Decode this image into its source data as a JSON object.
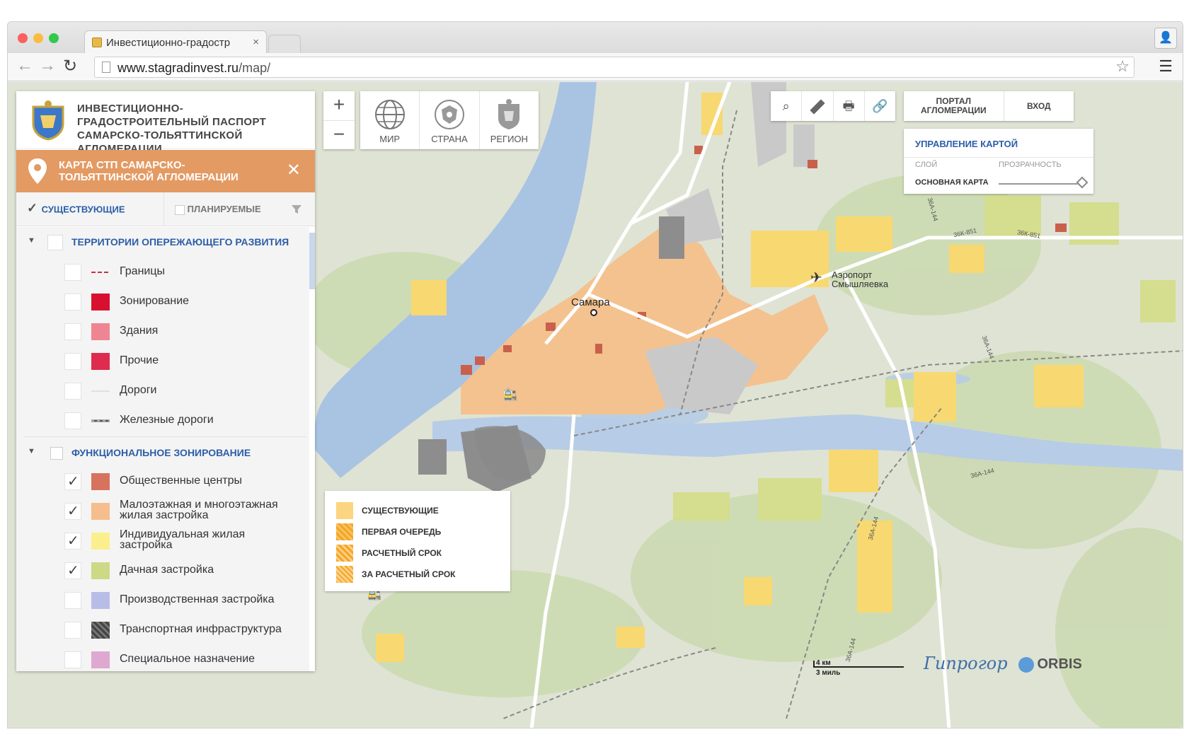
{
  "browser": {
    "tab_title": "Инвестиционно-градостр",
    "url_host": "www.stagradinvest.ru",
    "url_path": "/map/"
  },
  "header": {
    "title": "ИНВЕСТИЦИОННО-ГРАДОСТРОИТЕЛЬНЫЙ ПАСПОРТ САМАРСКО-ТОЛЬЯТТИНСКОЙ АГЛОМЕРАЦИИ"
  },
  "map_card": {
    "title": "КАРТА СТП САМАРСКО-ТОЛЬЯТТИНСКОЙ АГЛОМЕРАЦИИ"
  },
  "filters": {
    "existing": "СУЩЕСТВУЮЩИЕ",
    "planned": "ПЛАНИРУЕМЫЕ"
  },
  "groups": [
    {
      "title": "ТЕРРИТОРИИ ОПЕРЕЖАЮЩЕГО РАЗВИТИЯ",
      "items": [
        {
          "label": "Границы",
          "checked": false,
          "color": "#c8313e"
        },
        {
          "label": "Зонирование",
          "checked": false,
          "color": "#d8102f"
        },
        {
          "label": "Здания",
          "checked": false,
          "color": "#ef8592"
        },
        {
          "label": "Прочие",
          "checked": false,
          "color": "#de2c4e"
        },
        {
          "label": "Дороги",
          "checked": false,
          "color": "#e8e8e8"
        },
        {
          "label": "Железные дороги",
          "checked": false,
          "color": "#666666"
        }
      ]
    },
    {
      "title": "ФУНКЦИОНАЛЬНОЕ ЗОНИРОВАНИЕ",
      "items": [
        {
          "label": "Общественные центры",
          "checked": true,
          "color": "#d7725f"
        },
        {
          "label": "Малоэтажная и многоэтажная жилая застройка",
          "checked": true,
          "color": "#f6bd8d"
        },
        {
          "label": "Индивидуальная жилая застройка",
          "checked": true,
          "color": "#fbef8d"
        },
        {
          "label": "Дачная застройка",
          "checked": true,
          "color": "#cdd985"
        },
        {
          "label": "Производственная застройка",
          "checked": false,
          "color": "#b8bde7"
        },
        {
          "label": "Транспортная инфраструктура",
          "checked": false,
          "color": "#555555"
        },
        {
          "label": "Специальное назначение",
          "checked": false,
          "color": "#dfa8d0"
        }
      ]
    }
  ],
  "scale_buttons": [
    "МИР",
    "СТРАНА",
    "РЕГИОН"
  ],
  "top_right": {
    "portal": "ПОРТАЛ АГЛОМЕРАЦИИ",
    "login": "ВХОД"
  },
  "map_control": {
    "title": "УПРАВЛЕНИЕ КАРТОЙ",
    "col_layer": "СЛОЙ",
    "col_opacity": "ПРОЗРАЧНОСТЬ",
    "base_map": "ОСНОВНАЯ КАРТА",
    "opacity": 1.0
  },
  "legend": [
    {
      "label": "СУЩЕСТВУЮЩИЕ",
      "color": "#fbd580"
    },
    {
      "label": "ПЕРВАЯ ОЧЕРЕДЬ",
      "color": "#f5a623"
    },
    {
      "label": "РАСЧЕТНЫЙ СРОК",
      "color": "#f5a623"
    },
    {
      "label": "ЗА РАСЧЕТНЫЙ СРОК",
      "color": "#f5a623"
    }
  ],
  "map_labels": {
    "city": "Самара",
    "airport": "Аэропорт Смышляевка",
    "roads": [
      "36А-144",
      "36К-851",
      "36К-851",
      "36А-144",
      "36А-144",
      "36А-144",
      "36А-144"
    ],
    "scale_km": "4 км",
    "scale_mi": "3 миль",
    "brand1": "Гипрогор",
    "brand2": "ORBIS"
  }
}
